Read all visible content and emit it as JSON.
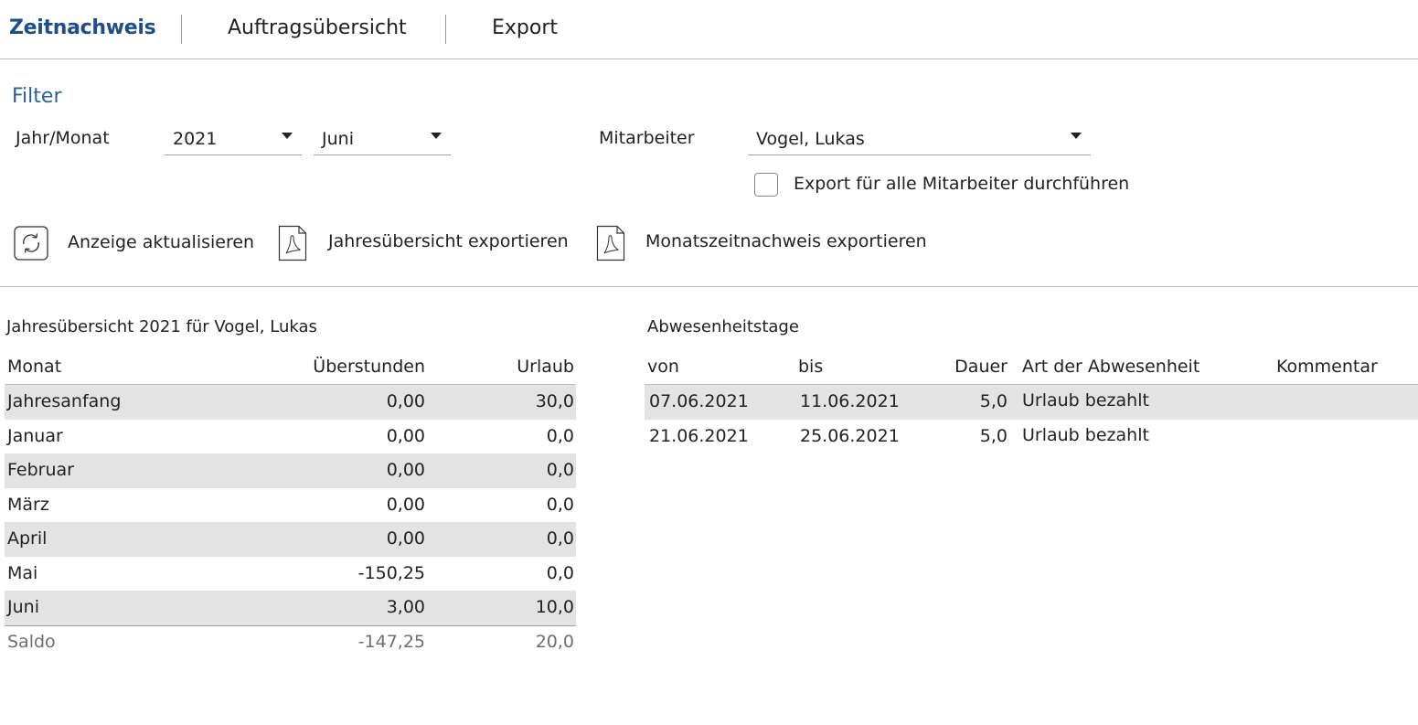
{
  "tabs": [
    {
      "label": "Zeitnachweis",
      "active": true
    },
    {
      "label": "Auftragsübersicht",
      "active": false
    },
    {
      "label": "Export",
      "active": false
    }
  ],
  "filter": {
    "title": "Filter",
    "jahr_monat_label": "Jahr/Monat",
    "year_value": "2021",
    "month_value": "Juni",
    "mitarbeiter_label": "Mitarbeiter",
    "mitarbeiter_value": "Vogel, Lukas",
    "export_all_label": "Export für alle Mitarbeiter durchführen",
    "export_all_checked": false
  },
  "actions": {
    "refresh": "Anzeige aktualisieren",
    "export_year": "Jahresübersicht exportieren",
    "export_month": "Monatszeitnachweis exportieren"
  },
  "icons": {
    "refresh": "refresh-icon",
    "pdf": "pdf-file-icon",
    "dropdown": "chevron-down-icon"
  },
  "colors": {
    "accent": "#1f4e8c",
    "row_shade": "#e3e3e3"
  },
  "year_overview": {
    "title": "Jahresübersicht 2021 für Vogel, Lukas",
    "headers": [
      "Monat",
      "Überstunden",
      "Urlaub"
    ],
    "rows": [
      [
        "Jahresanfang",
        "0,00",
        "30,0"
      ],
      [
        "Januar",
        "0,00",
        "0,0"
      ],
      [
        "Februar",
        "0,00",
        "0,0"
      ],
      [
        "März",
        "0,00",
        "0,0"
      ],
      [
        "April",
        "0,00",
        "0,0"
      ],
      [
        "Mai",
        "-150,25",
        "0,0"
      ],
      [
        "Juni",
        "3,00",
        "10,0"
      ]
    ],
    "saldo": [
      "Saldo",
      "-147,25",
      "20,0"
    ]
  },
  "absence": {
    "title": "Abwesenheitstage",
    "headers": [
      "von",
      "bis",
      "Dauer",
      "Art der Abwesenheit",
      "Kommentar"
    ],
    "rows": [
      [
        "07.06.2021",
        "11.06.2021",
        "5,0",
        "Urlaub bezahlt",
        ""
      ],
      [
        "21.06.2021",
        "25.06.2021",
        "5,0",
        "Urlaub bezahlt",
        ""
      ]
    ]
  }
}
